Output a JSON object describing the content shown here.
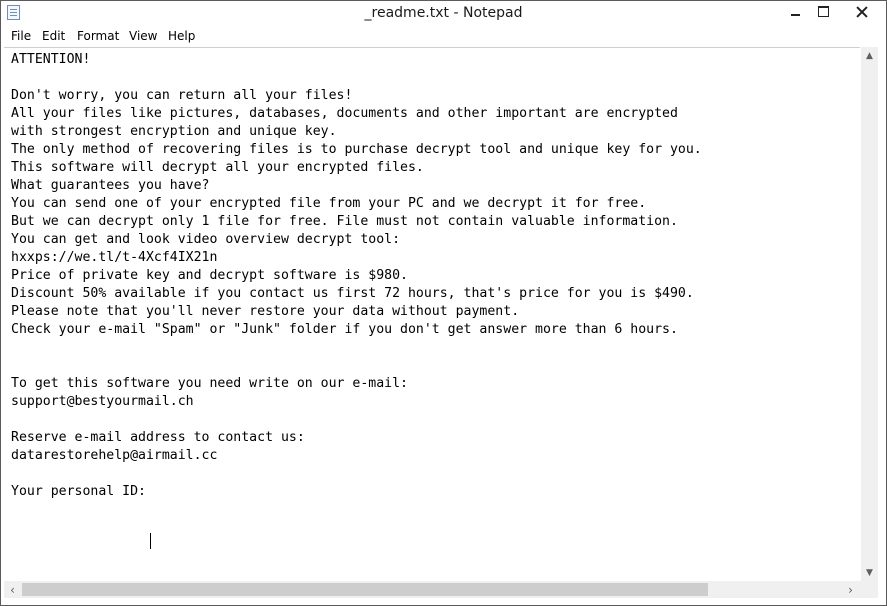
{
  "window": {
    "title": "_readme.txt - Notepad"
  },
  "menu": {
    "items": [
      "File",
      "Edit",
      "Format",
      "View",
      "Help"
    ]
  },
  "editor": {
    "content": "ATTENTION!\n\nDon't worry, you can return all your files!\nAll your files like pictures, databases, documents and other important are encrypted\nwith strongest encryption and unique key.\nThe only method of recovering files is to purchase decrypt tool and unique key for you.\nThis software will decrypt all your encrypted files.\nWhat guarantees you have?\nYou can send one of your encrypted file from your PC and we decrypt it for free.\nBut we can decrypt only 1 file for free. File must not contain valuable information.\nYou can get and look video overview decrypt tool:\nhxxps://we.tl/t-4Xcf4IX21n\nPrice of private key and decrypt software is $980.\nDiscount 50% available if you contact us first 72 hours, that's price for you is $490.\nPlease note that you'll never restore your data without payment.\nCheck your e-mail \"Spam\" or \"Junk\" folder if you don't get answer more than 6 hours.\n\n\nTo get this software you need write on our e-mail:\nsupport@bestyourmail.ch\n\nReserve e-mail address to contact us:\ndatarestorehelp@airmail.cc\n\nYour personal ID:"
  },
  "icons": {
    "app": "notepad-icon",
    "minimize": "minimize-icon",
    "maximize": "maximize-icon",
    "close": "close-icon",
    "scroll_up": "arrow-up-icon",
    "scroll_down": "arrow-down-icon",
    "scroll_left": "arrow-left-icon",
    "scroll_right": "arrow-right-icon"
  },
  "colors": {
    "window_border": "#5b5b5b",
    "scrollbar_bg": "#f0f0f0",
    "scrollbar_thumb": "#cdcdcd"
  }
}
